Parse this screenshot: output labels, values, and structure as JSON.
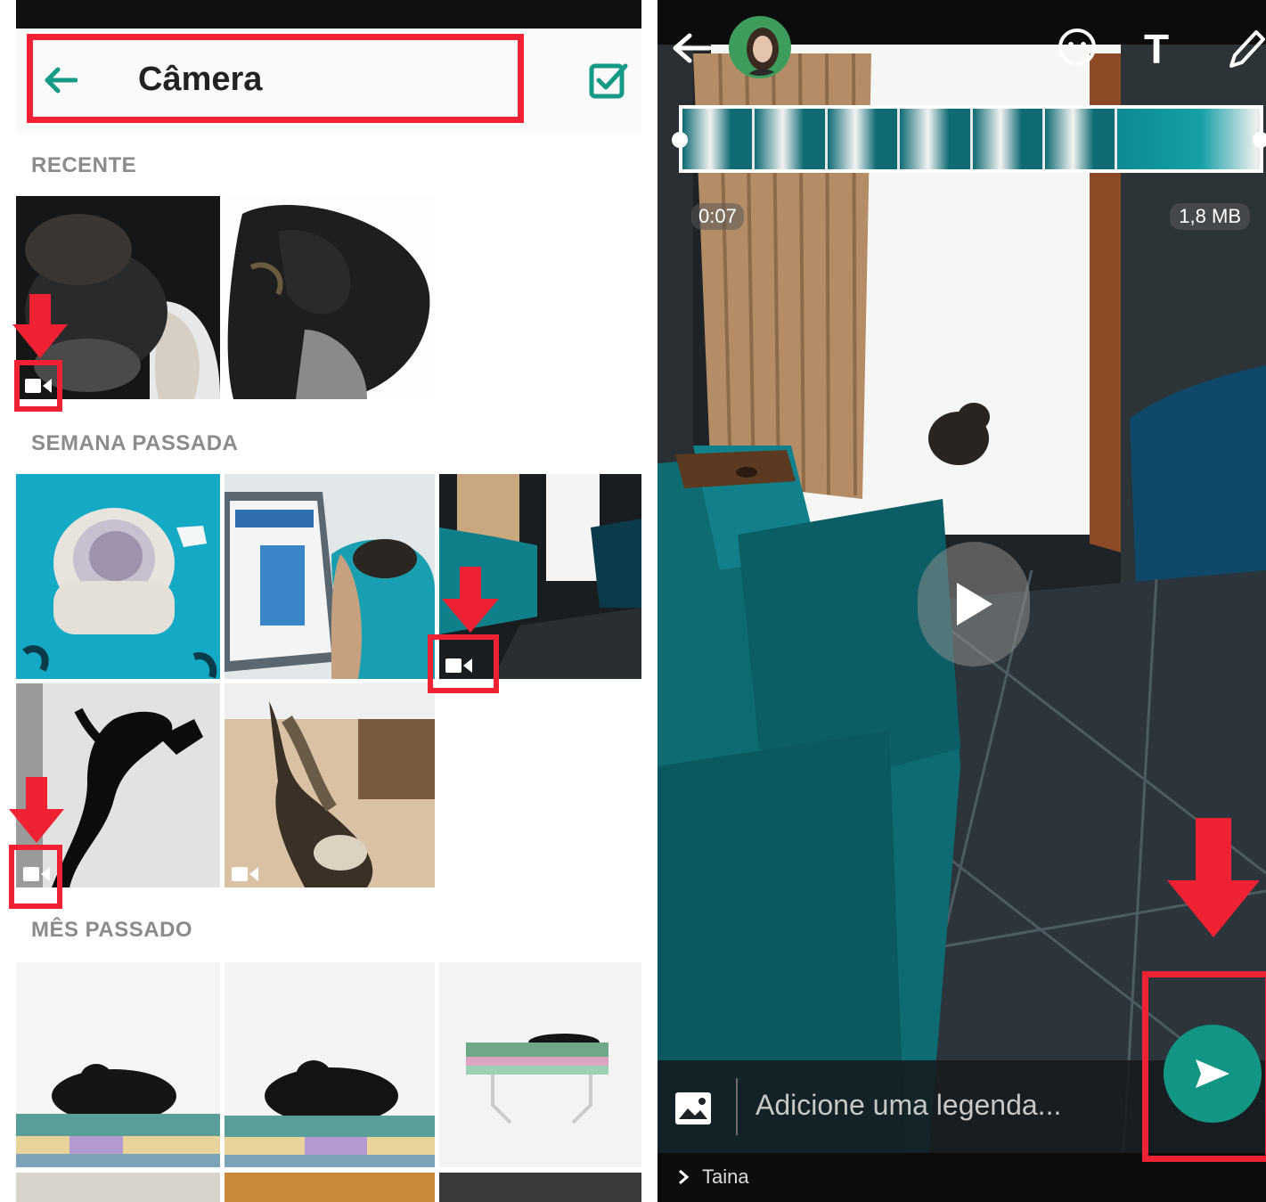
{
  "gallery": {
    "title": "Câmera",
    "sections": [
      {
        "label": "RECENTE"
      },
      {
        "label": "SEMANA PASSADA"
      },
      {
        "label": "MÊS PASSADO"
      }
    ]
  },
  "editor": {
    "duration": "0:07",
    "file_size": "1,8 MB",
    "caption_placeholder": "Adicione uma legenda...",
    "recipient": "Taina",
    "text_tool": "T"
  },
  "icons": {
    "back": "arrow-left-icon",
    "confirm": "checkbox-icon",
    "video": "video-camera-icon",
    "emoji": "emoji-icon",
    "text": "text-icon",
    "pencil": "pencil-icon",
    "play": "play-icon",
    "send": "send-icon",
    "image": "image-icon",
    "chevron": "chevron-right-icon"
  },
  "colors": {
    "accent": "#129683",
    "highlight": "#ee2233"
  }
}
